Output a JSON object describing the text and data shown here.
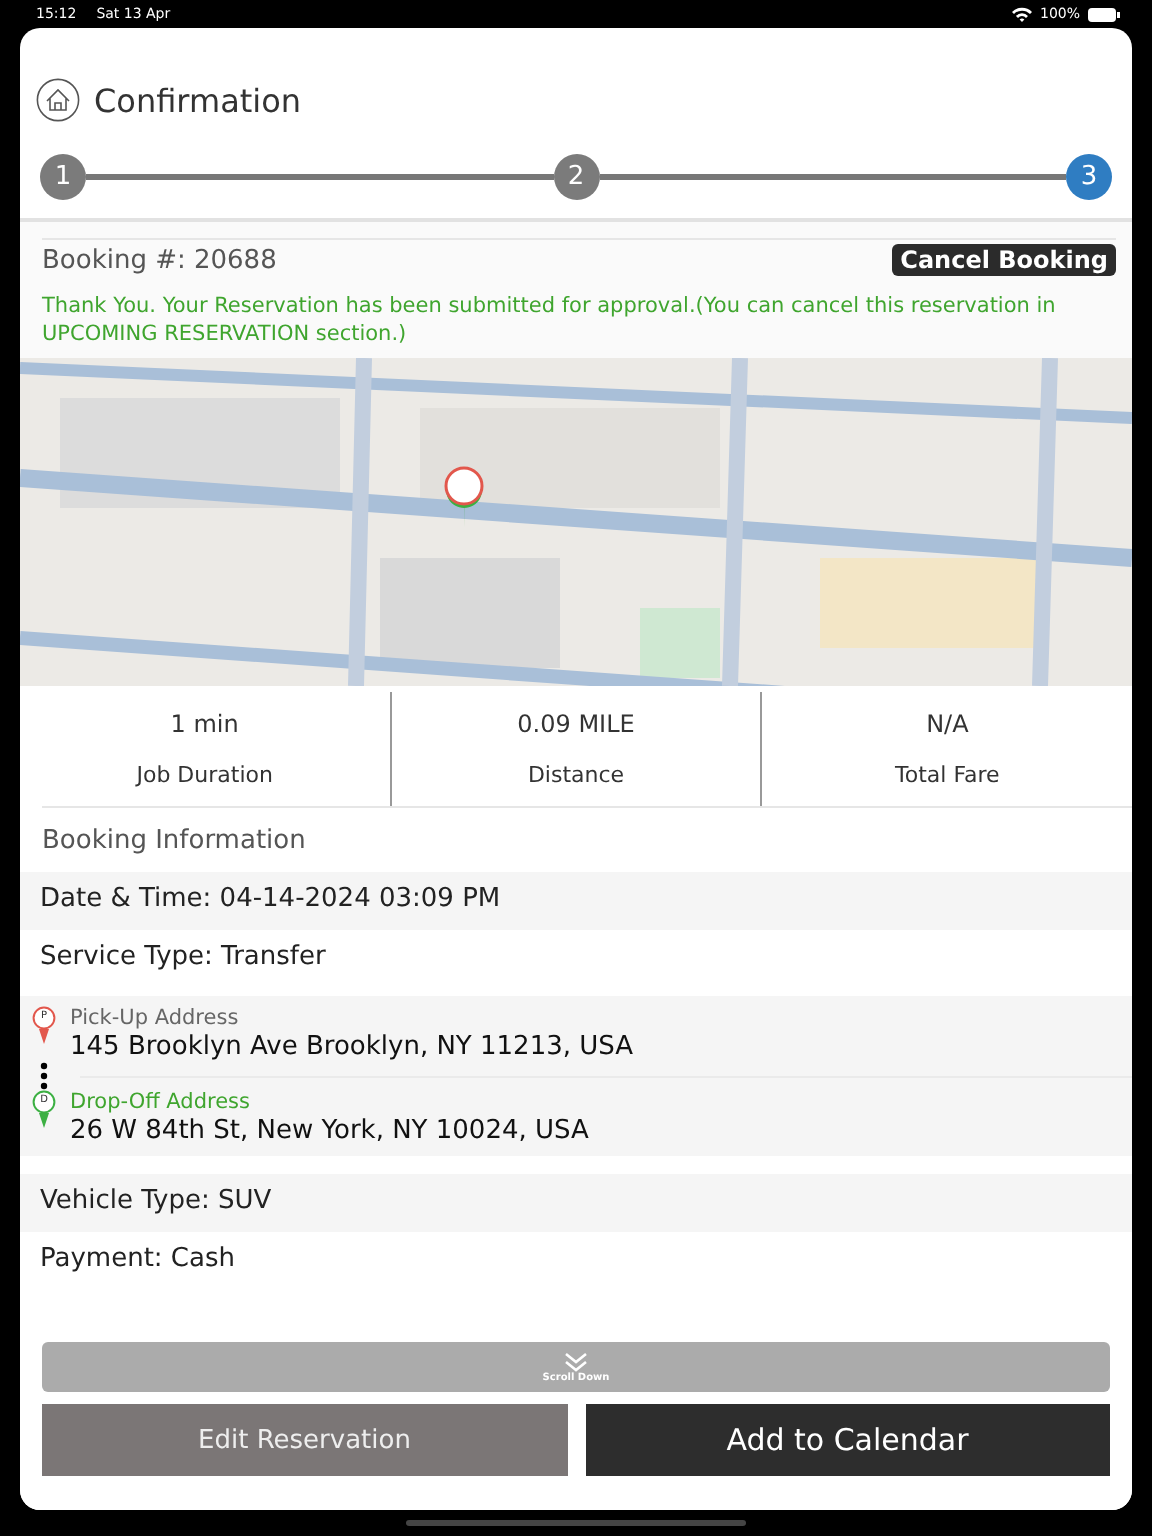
{
  "status_bar": {
    "time": "15:12",
    "date": "Sat 13 Apr",
    "battery": "100%"
  },
  "header": {
    "title": "Confirmation"
  },
  "steps": [
    {
      "label": "1",
      "selected": false
    },
    {
      "label": "2",
      "selected": false
    },
    {
      "label": "3",
      "selected": true
    }
  ],
  "booking": {
    "number": "Booking #: 20688",
    "cancel_button": "Cancel Booking",
    "message": "Thank You. Your Reservation has been submitted for approval.(You can cancel this reservation in UPCOMING RESERVATION section.)"
  },
  "stats": [
    {
      "value": "1 min",
      "label": "Job Duration"
    },
    {
      "value": "0.09 MILE",
      "label": "Distance"
    },
    {
      "value": "N/A",
      "label": "Total Fare"
    }
  ],
  "section_title": "Booking Information",
  "rows_top": [
    {
      "text": "Date & Time: 04-14-2024 03:09 PM"
    },
    {
      "text": "Service Type: Transfer"
    }
  ],
  "addresses": [
    {
      "marker": "P",
      "label": "Pick-Up Address",
      "value": "145 Brooklyn Ave Brooklyn, NY 11213, USA",
      "color": "#e2574c"
    },
    {
      "marker": "D",
      "label": "Drop-Off Address",
      "value": "26 W 84th St, New York, NY 10024, USA",
      "color": "#3cb043"
    }
  ],
  "rows_bottom": [
    {
      "text": "Vehicle Type: SUV"
    },
    {
      "text": "Payment: Cash"
    }
  ],
  "scroll_button": "Scroll Down",
  "buttons": [
    {
      "label": "Edit Reservation",
      "kind": "secondary"
    },
    {
      "label": "Add to Calendar",
      "kind": "primary"
    }
  ]
}
